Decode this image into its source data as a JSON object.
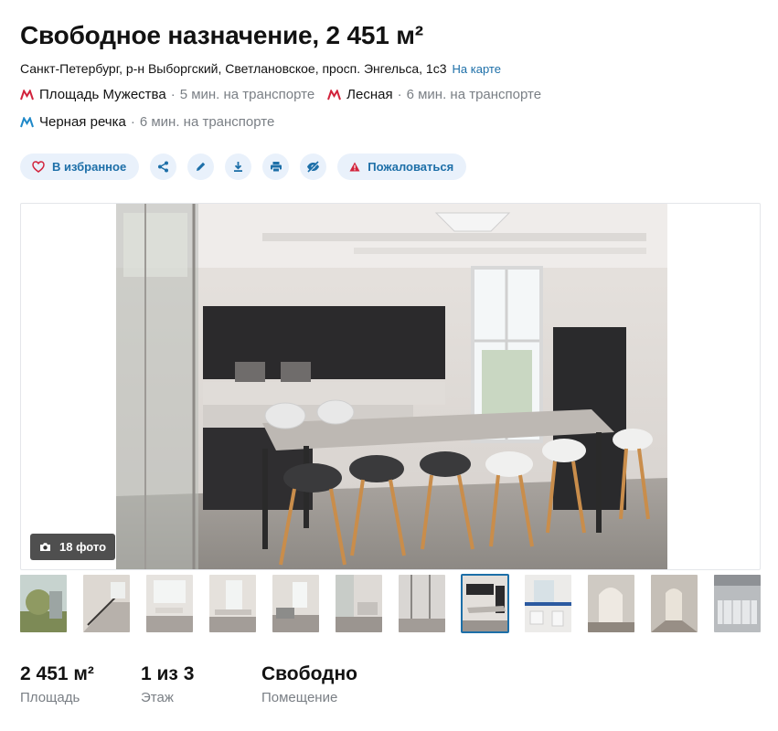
{
  "listing": {
    "title": "Свободное назначение, 2 451 м²",
    "address": "Санкт-Петербург, р-н Выборгский, Светлановское, просп. Энгельса, 1с3",
    "map_link": "На карте"
  },
  "metro": [
    {
      "name": "Площадь Мужества",
      "time": "5 мин. на транспорте",
      "color": "#d2233c"
    },
    {
      "name": "Лесная",
      "time": "6 мин. на транспорте",
      "color": "#d2233c"
    },
    {
      "name": "Черная речка",
      "time": "6 мин. на транспорте",
      "color": "#1e88c8"
    }
  ],
  "actions": {
    "favorite_label": "В избранное",
    "complain_label": "Пожаловаться",
    "icons": [
      "share-icon",
      "edit-icon",
      "download-icon",
      "print-icon",
      "hide-icon"
    ]
  },
  "gallery": {
    "photo_count": "18 фото",
    "thumbnail_count": 12,
    "active_thumbnail": 8
  },
  "facts": [
    {
      "value": "2 451 м²",
      "label": "Площадь"
    },
    {
      "value": "1 из 3",
      "label": "Этаж"
    },
    {
      "value": "Свободно",
      "label": "Помещение"
    }
  ],
  "colors": {
    "accent": "#1d6fa8",
    "pill_bg": "#e9f1fb",
    "metro_red": "#d2233c",
    "metro_blue": "#1e88c8",
    "muted": "#7a7f85"
  }
}
